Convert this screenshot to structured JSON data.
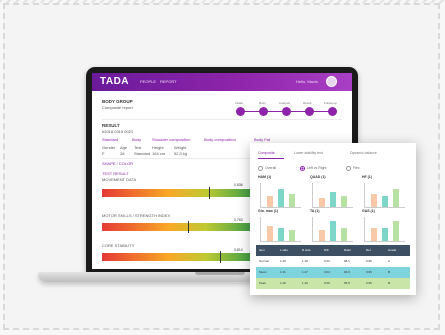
{
  "app": {
    "logo": "TADA",
    "nav": [
      "PEOPLE",
      "REPORT"
    ],
    "user": "Hello, Mavis"
  },
  "profile": {
    "title": "BODY GROUP",
    "subtitle": "Composite report",
    "id_label": "RESULT",
    "id_value": "#2018 0315 0021",
    "chips": [
      "Standard",
      "Body",
      "Shoulder composition",
      "Body-composition",
      "Body Fat"
    ],
    "meta_headers": [
      "Gender",
      "Age",
      "Test",
      "Height",
      "Weight",
      "Body fat",
      "Examiner"
    ],
    "meta_values": [
      "F",
      "26",
      "Standard",
      "164 cm",
      "52.3 kg",
      "",
      ""
    ]
  },
  "stepper": {
    "labels": [
      "Intake",
      "Body",
      "Analysis",
      "Result",
      "Follow-up"
    ]
  },
  "section": {
    "title": "SHAPE / COLOR",
    "sub": "TEST RESULT"
  },
  "gauges": [
    {
      "label": "MOVEMENT DATA",
      "value_text": "0.836",
      "level": 0.72
    },
    {
      "label": "MOTOR SKILLS / STRENGTH INDEX",
      "value_text": "0.763",
      "level": 0.58
    },
    {
      "label": "CORE STABILITY",
      "value_text": "0.814",
      "level": 0.8
    }
  ],
  "card": {
    "tabs": [
      "Composite",
      "Lower stability test",
      "Dynamic balance"
    ],
    "radios": [
      "Overall",
      "Left vs Right",
      "Flex"
    ],
    "minis": [
      {
        "title": "HAM (1)",
        "values": [
          0.5,
          0.8,
          0.6
        ]
      },
      {
        "title": "QUAD (1)",
        "values": [
          0.4,
          0.7,
          0.5
        ]
      },
      {
        "title": "HF (1)",
        "values": [
          0.6,
          0.5,
          0.8
        ]
      },
      {
        "title": "Glu. max (1)",
        "values": [
          0.7,
          0.6,
          0.5
        ]
      },
      {
        "title": "TA (1)",
        "values": [
          0.5,
          0.9,
          0.6
        ]
      },
      {
        "title": "GAS (1)",
        "values": [
          0.6,
          0.6,
          0.9
        ]
      }
    ],
    "table": {
      "headers": [
        "Item",
        "L side",
        "R side",
        "Diff",
        "Ratio",
        "Ref",
        "Grade"
      ],
      "rows": [
        [
          "Normal",
          "1.20",
          "1.18",
          "0.02",
          "98.1",
          "0.95",
          "A"
        ],
        [
          "Mean",
          "1.31",
          "1.27",
          "0.04",
          "96.9",
          "0.95",
          "B"
        ],
        [
          "Peak",
          "1.46",
          "1.40",
          "0.06",
          "95.8",
          "0.95",
          "B"
        ]
      ]
    }
  },
  "colors": {
    "brand_purple": "#8e24aa",
    "teal": "#7fd3dd",
    "green": "#c9e6a8",
    "peach": "#f7c9a8"
  }
}
